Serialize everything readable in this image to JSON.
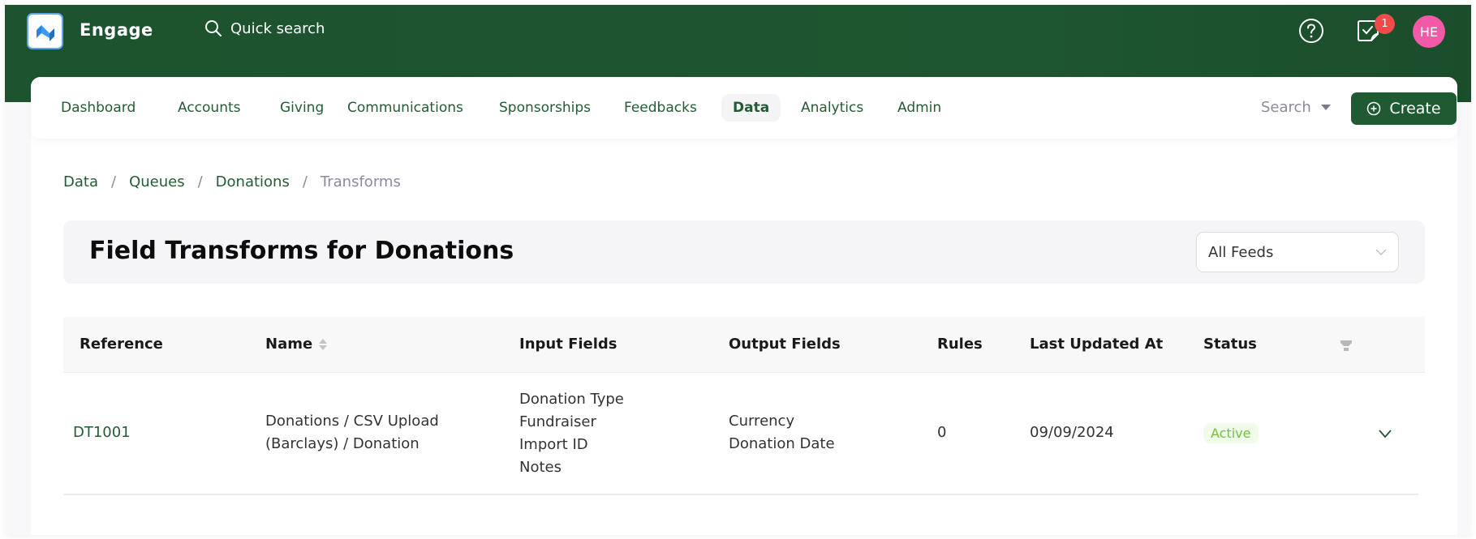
{
  "app": {
    "brand": "Engage",
    "quick_search": "Quick search",
    "notifications_count": "1",
    "avatar_initials": "HE"
  },
  "colors": {
    "brand_green": "#1f5a32",
    "badge_red": "#f04a4a",
    "avatar_pink": "#f25aa8",
    "status_active": "#72c041"
  },
  "nav": {
    "items": [
      {
        "label": "Dashboard"
      },
      {
        "label": "Accounts"
      },
      {
        "label": "Giving"
      },
      {
        "label": "Communications"
      },
      {
        "label": "Sponsorships"
      },
      {
        "label": "Feedbacks"
      },
      {
        "label": "Data",
        "active": true
      },
      {
        "label": "Analytics"
      },
      {
        "label": "Admin"
      }
    ],
    "search_label": "Search",
    "create_label": "Create"
  },
  "breadcrumb": [
    "Data",
    "Queues",
    "Donations",
    "Transforms"
  ],
  "page": {
    "title": "Field Transforms for Donations",
    "feed_filter": "All Feeds"
  },
  "table": {
    "columns": [
      "Reference",
      "Name",
      "Input Fields",
      "Output Fields",
      "Rules",
      "Last Updated At",
      "Status"
    ],
    "rows": [
      {
        "reference": "DT1001",
        "name_line1": "Donations / CSV Upload",
        "name_line2": "(Barclays) / Donation",
        "input_fields": [
          "Donation Type",
          "Fundraiser",
          "Import ID",
          "Notes"
        ],
        "output_fields": [
          "Currency",
          "Donation Date"
        ],
        "rules": "0",
        "last_updated": "09/09/2024",
        "status": "Active"
      }
    ]
  }
}
